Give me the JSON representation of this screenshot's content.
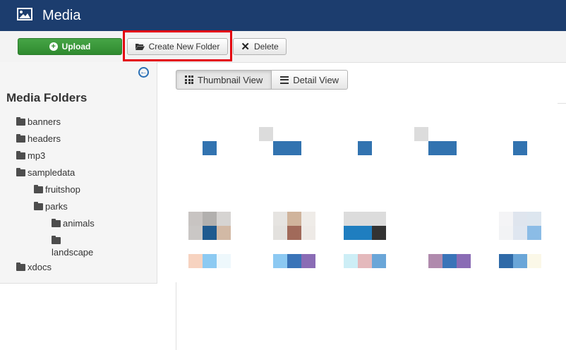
{
  "header": {
    "title": "Media",
    "icon": "image-icon"
  },
  "toolbar": {
    "upload_label": "Upload",
    "create_folder_label": "Create New Folder",
    "delete_label": "Delete",
    "upload_color": "#2f8a2f"
  },
  "sidebar": {
    "title": "Media Folders",
    "folders": [
      {
        "label": "banners"
      },
      {
        "label": "headers"
      },
      {
        "label": "mp3"
      },
      {
        "label": "sampledata"
      },
      {
        "label": "fruitshop"
      },
      {
        "label": "parks"
      },
      {
        "label": "animals"
      },
      {
        "label": "landscape"
      },
      {
        "label": "xdocs"
      }
    ]
  },
  "view": {
    "thumbnail_label": "Thumbnail View",
    "detail_label": "Detail View",
    "active": "thumbnail"
  },
  "colors": {
    "header_bg": "#1c3d6e",
    "highlight": "#e3000f",
    "accent": "#2a6fb5"
  }
}
